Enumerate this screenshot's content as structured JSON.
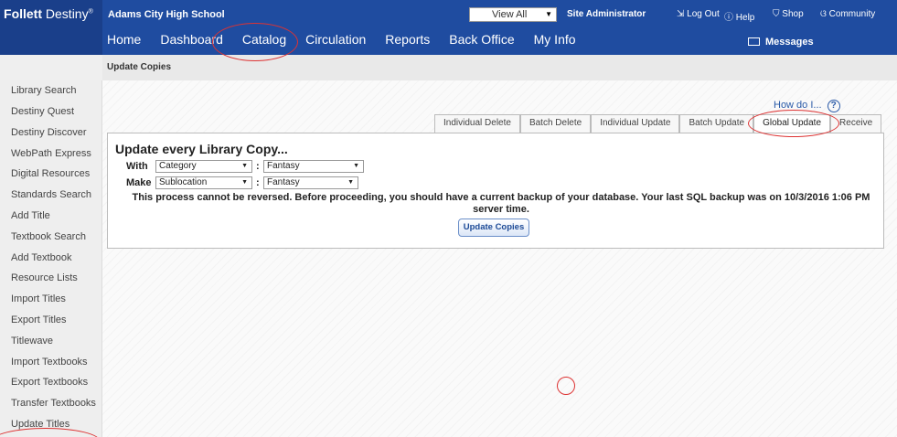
{
  "brand": {
    "name_bold": "ollett",
    "name_rest": " Destiny",
    "trademark": "®"
  },
  "header": {
    "school": "Adams City High School",
    "site_select": "View All",
    "admin": "Site Administrator",
    "logout": "Log Out",
    "help": "Help",
    "shop": "Shop",
    "community": "Community",
    "messages": "Messages"
  },
  "nav": [
    "Home",
    "Dashboard",
    "Catalog",
    "Circulation",
    "Reports",
    "Back Office",
    "My Info"
  ],
  "breadcrumb": "Update Copies",
  "sidebar": [
    "Library Search",
    "Destiny Quest",
    "Destiny Discover",
    "WebPath Express",
    "Digital Resources",
    "Standards Search",
    "Add Title",
    "Textbook Search",
    "Add Textbook",
    "Resource Lists",
    "Import Titles",
    "Export Titles",
    "Titlewave",
    "Import Textbooks",
    "Export Textbooks",
    "Transfer Textbooks",
    "Update Titles"
  ],
  "howdo": "How do I...",
  "tabs": [
    "Individual Delete",
    "Batch Delete",
    "Individual Update",
    "Batch Update",
    "Global Update",
    "Receive"
  ],
  "panel": {
    "heading": "Update every Library Copy...",
    "with_label": "With",
    "with_field": "Category",
    "with_value": "Fantasy",
    "make_label": "Make",
    "make_field": "Sublocation",
    "make_value": "Fantasy",
    "warning": "This process cannot be reversed. Before proceeding, you should have a current backup of your database. Your last SQL backup was on 10/3/2016 1:06 PM server time.",
    "button": "Update Copies"
  },
  "colors": {
    "header_bg": "#1f4ca0",
    "annotation": "#d33"
  }
}
